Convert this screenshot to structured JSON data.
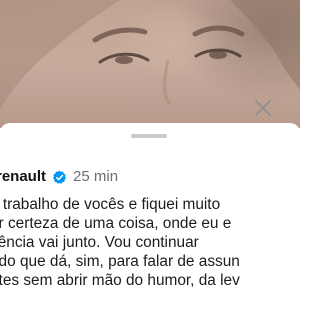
{
  "post": {
    "username": "renault",
    "verified_icon": "verified-badge-icon",
    "time_ago": "25 min",
    "caption_lines": [
      "o trabalho de vocês e fiquei muito",
      "er certeza de uma coisa, onde eu e",
      "sência vai junto. Vou continuar",
      "ndo que dá, sim, para falar de assun",
      "ntes sem abrir mão do humor, da lev"
    ]
  },
  "colors": {
    "accent": "#0095f6",
    "text": "#1c1c1e",
    "secondary_text": "#6e6e73",
    "grabber": "#c9c9cf"
  },
  "icons": {
    "close": "close-icon"
  }
}
